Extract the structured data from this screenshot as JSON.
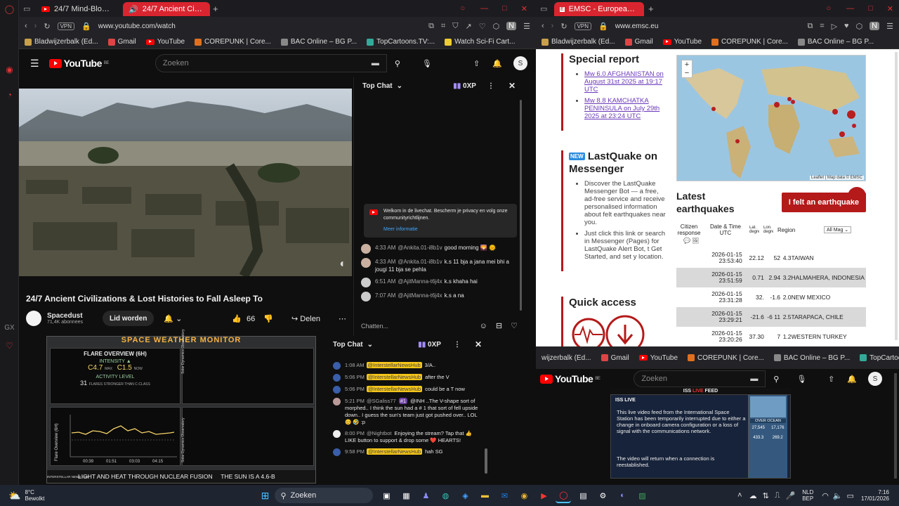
{
  "left_window": {
    "tabs": [
      {
        "label": "24/7 Mind-Blowing Space",
        "active": false
      },
      {
        "label": "24/7 Ancient Civilizatio",
        "active": true
      }
    ],
    "url": "www.youtube.com/watch",
    "vpn": "VPN",
    "bookmarks": [
      "Bladwijzerbalk (Ed...",
      "Gmail",
      "YouTube",
      "COREPUNK | Core...",
      "BAC Online – BG P...",
      "TopCartoons.TV:...",
      "Watch Sci-Fi Cart..."
    ],
    "yt": {
      "logo": "YouTube",
      "region": "BE",
      "search_placeholder": "Zoeken",
      "avatar": "S",
      "video_title": "24/7 Ancient Civilizations & Lost Histories to Fall Asleep To",
      "channel": "Spacedust",
      "subscribers": "71,4K abonnees",
      "join_label": "Lid worden",
      "likes": "66",
      "share_label": "Delen"
    },
    "chat": {
      "mode": "Top Chat",
      "points": "0XP",
      "welcome": "Welkom in de livechat. Bescherm je privacy en volg onze communityrichtlijnen.",
      "more_info": "Meer informatie",
      "input_placeholder": "Chatten...",
      "messages": [
        {
          "time": "4:33 AM",
          "author": "@Ankita.01-i8b1v",
          "text": "good morning 🌄 🌞"
        },
        {
          "time": "4:33 AM",
          "author": "@Ankita.01-i8b1v",
          "text": "k.s 11 bja a jana mei bhi a jougi 11 bja se pehla"
        },
        {
          "time": "6:51 AM",
          "author": "@AjitManna-t6j4x",
          "text": "k.s khaha hai"
        },
        {
          "time": "7:07 AM",
          "author": "@AjitManna-t6j4x",
          "text": "k.s a na"
        }
      ]
    }
  },
  "right_window": {
    "tab": "EMSC - European-Mediter",
    "url": "www.emsc.eu",
    "vpn": "VPN",
    "bookmarks": [
      "Bladwijzerbalk (Ed...",
      "Gmail",
      "YouTube",
      "COREPUNK | Core...",
      "BAC Online – BG P..."
    ],
    "special_report": {
      "title": "Special report",
      "items": [
        "Mw 6.0 AFGHANISTAN on August 31st 2025 at 19:17 UTC",
        "Mw 8.8 KAMCHATKA PENINSULA on July 29th 2025 at 23:24 UTC"
      ]
    },
    "lastquake": {
      "badge": "NEW",
      "title": "LastQuake on Messenger",
      "items": [
        "Discover the LastQuake Messenger Bot — a free, ad-free service and receive personalised information about felt earthquakes near you.",
        "Just click this link or search in Messenger (Pages) for LastQuake Alert Bot, t Get Started, and set y location."
      ]
    },
    "quick_access": "Quick access",
    "map_attribution": "Leaflet | Map data © EMSC",
    "latest": {
      "title": "Latest earthquakes",
      "felt_button": "I felt an earthquake",
      "headers": [
        "Citizen response",
        "Date & Time UTC",
        "Lat. degrees",
        "Lon. degrees",
        "Mag",
        "Region"
      ],
      "mag_filter": "All Mag",
      "rows": [
        {
          "date": "2026-01-15",
          "time": "23:53:40",
          "lat": "22.12",
          "lon": "52",
          "mag": "4.3",
          "region": "TAIWAN"
        },
        {
          "date": "2026-01-15",
          "time": "23:51:59",
          "lat": "0.71",
          "lon": "2.94",
          "mag": "3.2",
          "region": "HALMAHERA, INDONESIA"
        },
        {
          "date": "2026-01-15",
          "time": "23:31:28",
          "lat": "32.",
          "lon": "-1.6",
          "mag": "2.0",
          "region": "NEW MEXICO"
        },
        {
          "date": "2026-01-15",
          "time": "23:29:21",
          "lat": "-21.6",
          "lon": "-6 11",
          "mag": "2.5",
          "region": "TARAPACA, CHILE"
        },
        {
          "date": "2026-01-15",
          "time": "23:20:26",
          "lat": "37.30",
          "lon": "7",
          "mag": "1.2",
          "region": "WESTERN TURKEY"
        }
      ]
    }
  },
  "monitor": {
    "title": "SPACE WEATHER MONITOR",
    "flare_title": "FLARE OVERVIEW (6H)",
    "intensity_label": "INTENSITY",
    "max_value": "C4.7",
    "max_label": "MAX",
    "now_value": "C1.5",
    "now_label": "NOW",
    "activity_label": "ACTIVITY LEVEL",
    "activity_value": "31",
    "activity_desc": "FLARES STRONGER THAN C-CLASS",
    "chart_axis": "Flare Overview (6H)",
    "side_label": "Solar Dynamics Observatory",
    "times": [
      "00:39",
      "01:51",
      "03:03",
      "04:15"
    ],
    "ticker": "LIGHT AND HEAT THROUGH NUCLEAR FUSION     THE SUN IS A 4.6-B",
    "brand": "INTERSTELLAR NEWS HUB"
  },
  "chat2": {
    "mode": "Top Chat",
    "points": "0XP",
    "messages": [
      {
        "time": "1:08 AM",
        "author": "@InterstellarNewsHub",
        "text": "3/A..",
        "highlight": true
      },
      {
        "time": "5:06 PM",
        "author": "@InterstellarNewsHub",
        "text": "after the V",
        "highlight": true
      },
      {
        "time": "5:06 PM",
        "author": "@InterstellarNewsHub",
        "text": "could be a T now",
        "highlight": true
      },
      {
        "time": "5:21 PM",
        "author": "@SGaliss77",
        "badge": "#1",
        "text": "@INH ..The V-shape sort of morphed.. I think the sun had a # 1 that sort of fell upside down.. I guess the sun's team just got pushed over.. LOL 😊 🤣 :p",
        "highlight": false
      },
      {
        "time": "8:00 PM",
        "author": "@Nightbot",
        "text": "Enjoying the stream? Tap that 👍 LIKE button to support & drop some ❤️ HEARTS!",
        "highlight": false
      },
      {
        "time": "9:58 PM",
        "author": "@InterstellarNewsHub",
        "text": "hah SG",
        "highlight": true
      }
    ]
  },
  "bottom_right": {
    "bookmarks": [
      "wijzerbalk (Ed...",
      "Gmail",
      "YouTube",
      "COREPUNK | Core...",
      "BAC Online – BG P...",
      "TopCartoons.TV:..."
    ],
    "logo": "YouTube",
    "region": "BE",
    "search_placeholder": "Zoeken",
    "avatar": "S",
    "iss_header": "ISS LIVE FEED",
    "iss_live": "LIVE",
    "iss_badge": "ISS LIVE",
    "iss_text": "This live video feed from the International Space Station has been temporarily interrupted due to either a change in onboard camera configuration or a loss of signal with the communications network.",
    "iss_text2": "The video will return when a connection is reestablished.",
    "iss_stats": [
      "27,545",
      "17,176",
      "433.3",
      "269.2"
    ],
    "iss_region": "OVER OCEAN"
  },
  "taskbar": {
    "weather_temp": "8°C",
    "weather_desc": "Bewolkt",
    "search_label": "Zoeken",
    "lang": "NLD",
    "lang2": "BEP",
    "time": "7:16",
    "date": "17/01/2026"
  },
  "colors": {
    "emsc_red": "#b41a1a",
    "opera_red": "#d9252f",
    "yt_red": "#ff0000",
    "highlight_yellow": "#f5c518"
  }
}
